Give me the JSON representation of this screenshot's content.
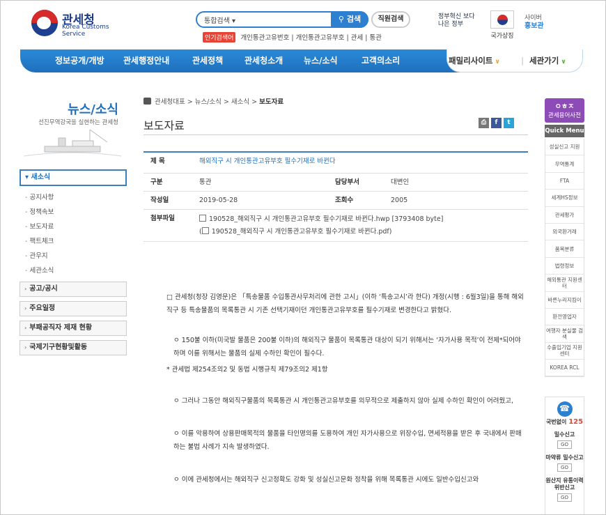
{
  "header": {
    "logo_ko": "관세청",
    "logo_en": "Korea Customs Service",
    "search_scope": "통합검색 ▾",
    "search_button": "검색",
    "staff_search": "직원검색",
    "hot_badge": "인기검색어",
    "hot_keywords": "개인통관고유번호 | 개인통관고유부호 | 관세 | 통관",
    "gov_badge": "정부혁신 보다 나은 정부",
    "flag_label": "국가상징",
    "cyber_label": "사이버",
    "cyber_bold": "홍보관"
  },
  "nav": {
    "items": [
      "정보공개/개방",
      "관세행정안내",
      "관세정책",
      "관세청소개",
      "뉴스/소식",
      "고객의소리"
    ],
    "family": "패밀리사이트",
    "customs_go": "세관가기"
  },
  "sidebar": {
    "title": "뉴스/소식",
    "subtitle": "선진무역강국을 실현하는 관세청",
    "current": "▾ 새소식",
    "sub_items": [
      "공지사항",
      "정책속보",
      "보도자료",
      "팩트체크",
      "관우지",
      "세관소식"
    ],
    "sections": [
      "공고/공시",
      "주요일정",
      "부패공직자 제재 현황",
      "국제기구현황및활동"
    ]
  },
  "breadcrumb": {
    "path": "관세청대표 > 뉴스/소식 > 새소식 > ",
    "current": "보도자료"
  },
  "page_title": "보도자료",
  "share": {
    "print": "⎙",
    "facebook": "f",
    "twitter": "t"
  },
  "article": {
    "subject_label": "제   목",
    "subject": "해외직구 시 개인통관고유부호 필수기재로 바뀐다",
    "category_label": "구분",
    "category": "통관",
    "dept_label": "담당부서",
    "dept": "대변인",
    "date_label": "작성일",
    "date": "2019-05-28",
    "views_label": "조회수",
    "views": "2005",
    "attach_label": "첨부파일",
    "files": [
      "190528_해외직구 시 개인통관고유부호 필수기재로 바뀐다.hwp [3793408 byte]",
      "190528_해외직구 시 개인통관고유부호 필수기재로 바뀐다.pdf)"
    ],
    "file2_prefix": "(",
    "paragraphs": [
      "□ 관세청(청장 김영문)은 「특송물품 수입통관사무처리에 관한 고시」(이하 ‘특송고시’라 한다) 개정(시행 : 6월3일)을 통해 해외직구 등 특송물품의 목록통관 시 기존 선택기재이던 개인통관고유부호를 필수기재로 변경한다고 밝혔다.",
      "ㅇ 150불 이하(미국발 물품은 200불 이하)의 해외직구 물품이 목록통관 대상이 되기 위해서는 ‘자가사용 목적’이 전제*되어야 하며 이를 위해서는 물품의 실제 수하인 확인이 필수다.",
      "* 관세법 제254조의2 및 동법 시행규칙 제79조의2 제1항",
      "ㅇ 그러나 그동안 해외직구물품의 목록통관 시 개인통관고유부호를 의무적으로 제출하지 않아 실제 수하인 확인이 어려웠고,",
      "ㅇ 이를 악용하여 상용판매목적의 물품을 타인명의를 도용하여 개인 자가사용으로 위장수입, 면세적용을 받은 후 국내에서 판매하는 불법 사례가 지속 발생하였다.",
      "ㅇ 이에 관세청에서는 해외직구 신고정확도 강화 및 성실신고문화 정착을 위해 목록통관 시에도 일반수입신고와"
    ]
  },
  "quick": {
    "dict": "관세용어사전",
    "title": "Quick Menu",
    "items": [
      "성실신고 지원",
      "무역통계",
      "FTA",
      "세계HS정보",
      "관세평가",
      "외국환거래",
      "품목분류",
      "법령정보",
      "해외통관 지원센터",
      "바른누리지킴이",
      "환전영업자",
      "여행자 분실물 검색",
      "수출입기업 지원센터",
      "KOREA RCL"
    ],
    "call_label": "국번없이",
    "call_num": "125",
    "call_items": [
      "밀수신고",
      "마약류 밀수신고",
      "원산지 유통이력 위반신고"
    ],
    "go": "GO"
  }
}
